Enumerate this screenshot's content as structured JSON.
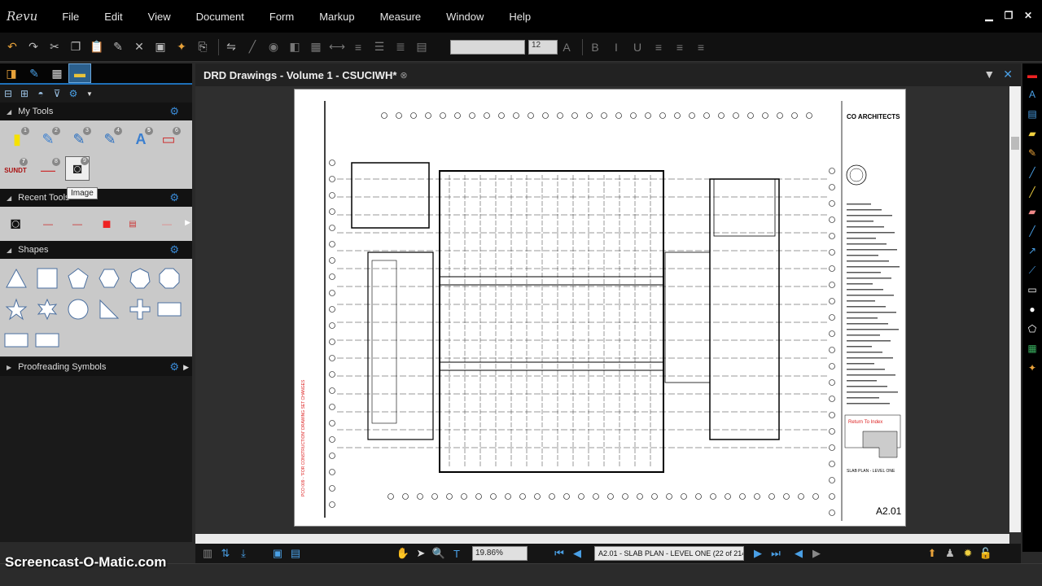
{
  "app": {
    "logo": "Revu"
  },
  "menu": [
    "File",
    "Edit",
    "View",
    "Document",
    "Form",
    "Markup",
    "Measure",
    "Window",
    "Help"
  ],
  "toolbar": {
    "font_value": "",
    "font_size": "12"
  },
  "left_panel": {
    "sections": {
      "my_tools": "My Tools",
      "recent_tools": "Recent Tools",
      "shapes": "Shapes",
      "proofreading": "Proofreading Symbols"
    },
    "tool_numbers": [
      "1",
      "2",
      "3",
      "4",
      "5",
      "6",
      "7",
      "8",
      "9"
    ],
    "tooltip": "Image",
    "sundt_label": "SUNDT"
  },
  "document": {
    "tab_title": "DRD Drawings - Volume 1 - CSUCIWH*",
    "firm": "CO ARCHITECTS",
    "sheet_number": "A2.01",
    "sheet_title": "SLAB PLAN - LEVEL ONE",
    "side_note": "PCO 009 - \"FOR CONSTRUCTION\" DRAWING SET CHANGES",
    "stamp_text": "Return To Index"
  },
  "statusbar": {
    "zoom": "19.86%",
    "page_nav": "A2.01 - SLAB PLAN - LEVEL ONE (22 of 214)"
  },
  "watermark": "Screencast-O-Matic.com"
}
